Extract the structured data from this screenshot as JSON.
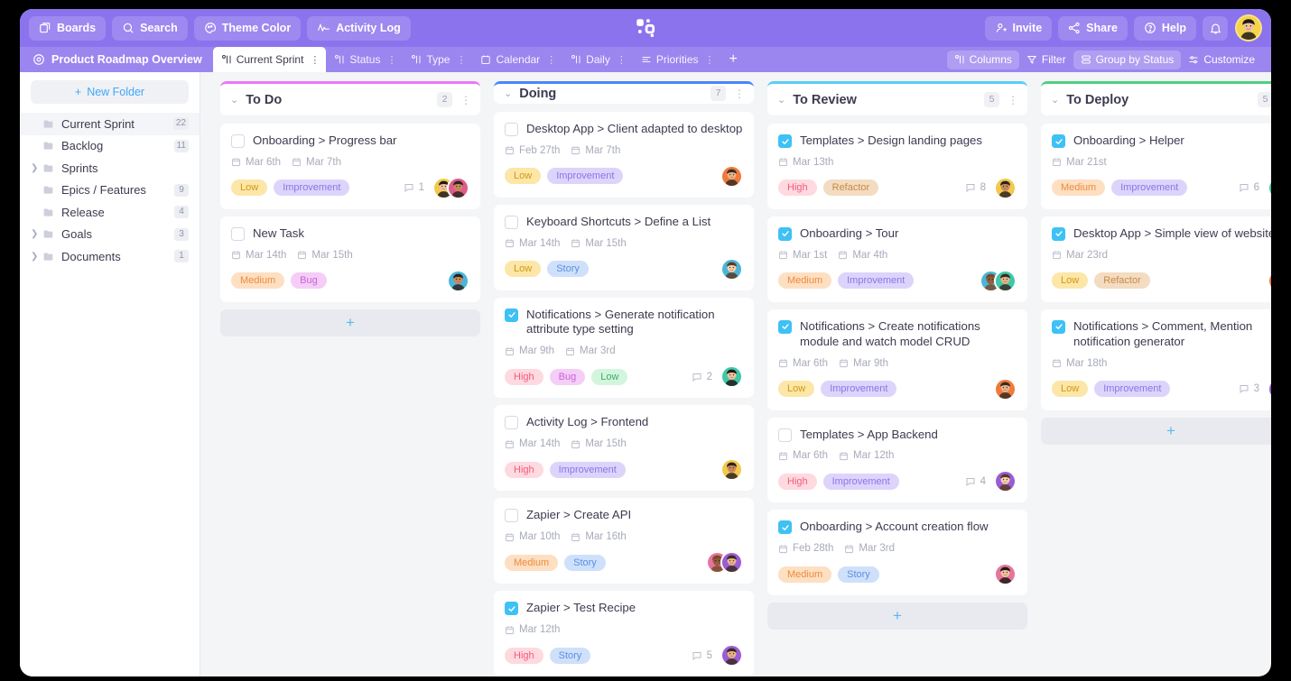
{
  "topbar": {
    "buttons": [
      {
        "label": "Boards",
        "icon": "boards-icon"
      },
      {
        "label": "Search",
        "icon": "search-icon"
      },
      {
        "label": "Theme Color",
        "icon": "palette-icon"
      },
      {
        "label": "Activity Log",
        "icon": "activity-icon"
      }
    ],
    "right_buttons": [
      {
        "label": "Invite",
        "icon": "user-plus-icon"
      },
      {
        "label": "Share",
        "icon": "share-icon"
      },
      {
        "label": "Help",
        "icon": "help-icon"
      }
    ],
    "bell": "notification-bell-icon",
    "avatar": "user-avatar",
    "logo": "app-logo",
    "bg_color": "#8b73ed"
  },
  "tabbar": {
    "board_title": "Product Roadmap Overview",
    "tabs": [
      {
        "label": "Current Sprint",
        "icon": "board-view-icon",
        "active": true
      },
      {
        "label": "Status",
        "icon": "board-view-icon",
        "active": false
      },
      {
        "label": "Type",
        "icon": "board-view-icon",
        "active": false
      },
      {
        "label": "Calendar",
        "icon": "calendar-icon",
        "active": false
      },
      {
        "label": "Daily",
        "icon": "board-view-icon",
        "active": false
      },
      {
        "label": "Priorities",
        "icon": "list-icon",
        "active": false
      }
    ],
    "add_tab": "+",
    "right_buttons": [
      {
        "label": "Columns",
        "icon": "columns-icon",
        "filled": true
      },
      {
        "label": "Filter",
        "icon": "filter-icon",
        "filled": false
      },
      {
        "label": "Group by Status",
        "icon": "group-icon",
        "filled": true
      },
      {
        "label": "Customize",
        "icon": "customize-icon",
        "filled": false
      }
    ],
    "bg_color": "#9b86ef"
  },
  "sidebar": {
    "new_folder_label": "New Folder",
    "items": [
      {
        "label": "Current Sprint",
        "count": "22",
        "caret": false,
        "active": true
      },
      {
        "label": "Backlog",
        "count": "11",
        "caret": false,
        "active": false
      },
      {
        "label": "Sprints",
        "count": "",
        "caret": true,
        "active": false
      },
      {
        "label": "Epics / Features",
        "count": "9",
        "caret": false,
        "active": false
      },
      {
        "label": "Release",
        "count": "4",
        "caret": false,
        "active": false
      },
      {
        "label": "Goals",
        "count": "3",
        "caret": true,
        "active": false
      },
      {
        "label": "Documents",
        "count": "1",
        "caret": true,
        "active": false
      }
    ]
  },
  "board": {
    "add_card_label": "+",
    "columns": [
      {
        "title": "To Do",
        "count": "2",
        "accent": "#e879f9",
        "show_add": true,
        "cards": [
          {
            "title": "Onboarding > Progress bar",
            "checked": false,
            "dates": [
              "Mar 6th",
              "Mar 7th"
            ],
            "tags": [
              {
                "label": "Low",
                "style": "t-low"
              },
              {
                "label": "Improvement",
                "style": "t-improvement"
              }
            ],
            "comments": "1",
            "avatars": [
              "#f2c94c",
              "#e05a8a"
            ]
          },
          {
            "title": "New Task",
            "checked": false,
            "dates": [
              "Mar 14th",
              "Mar 15th"
            ],
            "tags": [
              {
                "label": "Medium",
                "style": "t-medium"
              },
              {
                "label": "Bug",
                "style": "t-bug"
              }
            ],
            "comments": "",
            "avatars": [
              "#4ab5d8"
            ]
          }
        ]
      },
      {
        "title": "Doing",
        "count": "7",
        "accent": "#4a86f7",
        "show_add": false,
        "cards": [
          {
            "title": "Desktop App > Client adapted to desktop",
            "checked": false,
            "dates": [
              "Feb 27th",
              "Mar 7th"
            ],
            "tags": [
              {
                "label": "Low",
                "style": "t-low"
              },
              {
                "label": "Improvement",
                "style": "t-improvement"
              }
            ],
            "comments": "",
            "avatars": [
              "#ef7a3c"
            ]
          },
          {
            "title": "Keyboard Shortcuts > Define a List",
            "checked": false,
            "dates": [
              "Mar 14th",
              "Mar 15th"
            ],
            "tags": [
              {
                "label": "Low",
                "style": "t-low"
              },
              {
                "label": "Story",
                "style": "t-story"
              }
            ],
            "comments": "",
            "avatars": [
              "#4ab5d8"
            ]
          },
          {
            "title": "Notifications > Generate notification attribute type setting",
            "checked": true,
            "dates": [
              "Mar 9th",
              "Mar 3rd"
            ],
            "tags": [
              {
                "label": "High",
                "style": "t-high"
              },
              {
                "label": "Bug",
                "style": "t-bug"
              },
              {
                "label": "Low",
                "style": "t-lowgreen"
              }
            ],
            "comments": "2",
            "avatars": [
              "#3fc7a8"
            ]
          },
          {
            "title": "Activity Log > Frontend",
            "checked": false,
            "dates": [
              "Mar 14th",
              "Mar 15th"
            ],
            "tags": [
              {
                "label": "High",
                "style": "t-high"
              },
              {
                "label": "Improvement",
                "style": "t-improvement"
              }
            ],
            "comments": "",
            "avatars": [
              "#f2c94c"
            ]
          },
          {
            "title": "Zapier > Create API",
            "checked": false,
            "dates": [
              "Mar 10th",
              "Mar 16th"
            ],
            "tags": [
              {
                "label": "Medium",
                "style": "t-medium"
              },
              {
                "label": "Story",
                "style": "t-story"
              }
            ],
            "comments": "",
            "avatars": [
              "#e8739f",
              "#9b5cd6"
            ]
          },
          {
            "title": "Zapier > Test Recipe",
            "checked": true,
            "dates": [
              "Mar 12th"
            ],
            "tags": [
              {
                "label": "High",
                "style": "t-high"
              },
              {
                "label": "Story",
                "style": "t-story"
              }
            ],
            "comments": "5",
            "avatars": [
              "#9b5cd6"
            ]
          }
        ]
      },
      {
        "title": "To Review",
        "count": "5",
        "accent": "#5bcdf5",
        "show_add": true,
        "cards": [
          {
            "title": "Templates > Design landing pages",
            "checked": true,
            "dates": [
              "Mar 13th"
            ],
            "tags": [
              {
                "label": "High",
                "style": "t-high"
              },
              {
                "label": "Refactor",
                "style": "t-refactor"
              }
            ],
            "comments": "8",
            "avatars": [
              "#f2c94c"
            ]
          },
          {
            "title": "Onboarding > Tour",
            "checked": true,
            "dates": [
              "Mar 1st",
              "Mar 4th"
            ],
            "tags": [
              {
                "label": "Medium",
                "style": "t-medium"
              },
              {
                "label": "Improvement",
                "style": "t-improvement"
              }
            ],
            "comments": "",
            "avatars": [
              "#4ab5d8",
              "#3fc7a8"
            ]
          },
          {
            "title": "Notifications > Create notifications module and watch model CRUD",
            "checked": true,
            "dates": [
              "Mar 6th",
              "Mar 9th"
            ],
            "tags": [
              {
                "label": "Low",
                "style": "t-low"
              },
              {
                "label": "Improvement",
                "style": "t-improvement"
              }
            ],
            "comments": "",
            "avatars": [
              "#ef7a3c"
            ]
          },
          {
            "title": "Templates > App Backend",
            "checked": false,
            "dates": [
              "Mar 6th",
              "Mar 12th"
            ],
            "tags": [
              {
                "label": "High",
                "style": "t-high"
              },
              {
                "label": "Improvement",
                "style": "t-improvement"
              }
            ],
            "comments": "4",
            "avatars": [
              "#9b5cd6"
            ]
          },
          {
            "title": "Onboarding > Account creation flow",
            "checked": true,
            "dates": [
              "Feb 28th",
              "Mar 3rd"
            ],
            "tags": [
              {
                "label": "Medium",
                "style": "t-medium"
              },
              {
                "label": "Story",
                "style": "t-story"
              }
            ],
            "comments": "",
            "avatars": [
              "#e8739f"
            ]
          }
        ]
      },
      {
        "title": "To Deploy",
        "count": "5",
        "accent": "#4ed17f",
        "show_add": true,
        "cards": [
          {
            "title": "Onboarding > Helper",
            "checked": true,
            "dates": [
              "Mar 21st"
            ],
            "tags": [
              {
                "label": "Medium",
                "style": "t-medium"
              },
              {
                "label": "Improvement",
                "style": "t-improvement"
              }
            ],
            "comments": "6",
            "avatars": [
              "#3fc7a8"
            ]
          },
          {
            "title": "Desktop App > Simple view of website",
            "checked": true,
            "dates": [
              "Mar 23rd"
            ],
            "tags": [
              {
                "label": "Low",
                "style": "t-low"
              },
              {
                "label": "Refactor",
                "style": "t-refactor"
              }
            ],
            "comments": "",
            "avatars": [
              "#ef7a3c"
            ]
          },
          {
            "title": "Notifications > Comment, Mention notification generator",
            "checked": true,
            "dates": [
              "Mar 18th"
            ],
            "tags": [
              {
                "label": "Low",
                "style": "t-low"
              },
              {
                "label": "Improvement",
                "style": "t-improvement"
              }
            ],
            "comments": "3",
            "avatars": [
              "#9b5cd6"
            ]
          }
        ]
      }
    ]
  }
}
